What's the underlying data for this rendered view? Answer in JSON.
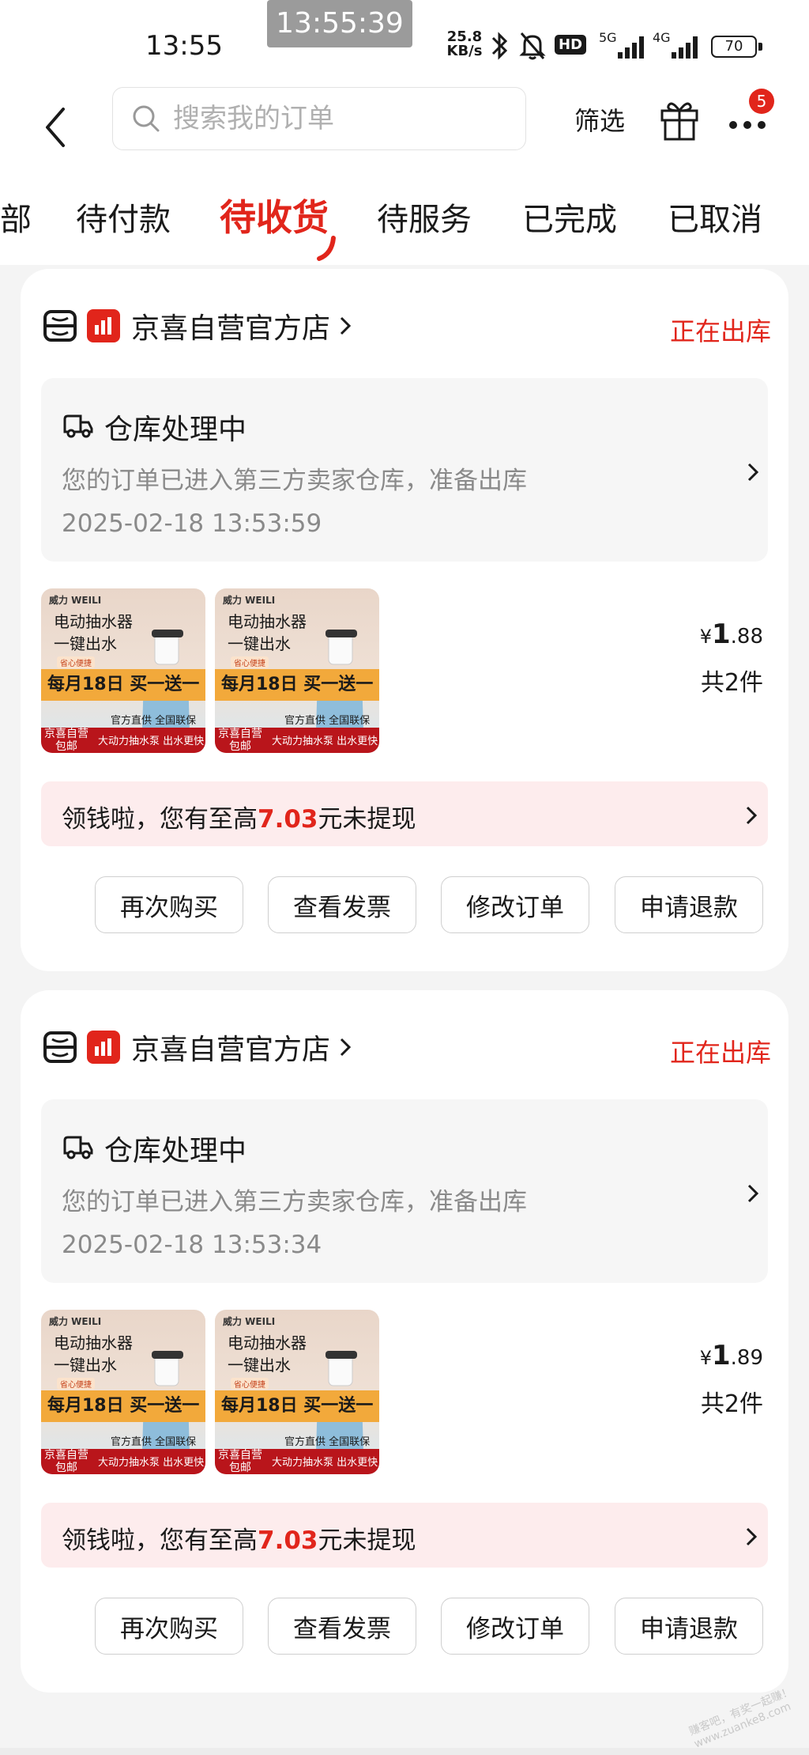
{
  "status_bar": {
    "time": "13:55",
    "overlay_time": "13:55:39",
    "net_speed_value": "25.8",
    "net_speed_unit": "KB/s",
    "hd_label": "HD",
    "net_5g": "5G",
    "net_4g": "4G",
    "battery": "70"
  },
  "header": {
    "search_placeholder": "搜索我的订单",
    "filter_label": "筛选",
    "more_badge": "5"
  },
  "tabs": [
    {
      "label": "部",
      "active": false
    },
    {
      "label": "待付款",
      "active": false
    },
    {
      "label": "待收货",
      "active": true
    },
    {
      "label": "待服务",
      "active": false
    },
    {
      "label": "已完成",
      "active": false
    },
    {
      "label": "已取消",
      "active": false
    }
  ],
  "orders": [
    {
      "shop_name": "京喜自营官方店",
      "status": "正在出库",
      "logistics_title": "仓库处理中",
      "logistics_desc": "您的订单已进入第三方卖家仓库，准备出库",
      "logistics_time": "2025-02-18 13:53:59",
      "product": {
        "brand": "威力 WEILI",
        "title_line1": "电动抽水器",
        "title_line2": "一键出水",
        "tag": "省心便捷",
        "promo": "每月18日 买一送一",
        "foot_a": "京喜自营 包邮",
        "foot_b": "大动力抽水泵 出水更快",
        "foot_c": "官方直供 全国联保"
      },
      "price_currency": "¥",
      "price_int": "1",
      "price_dec": ".88",
      "quantity": "共2件",
      "cash_prefix": "领钱啦，您有至高",
      "cash_amount": "7.03",
      "cash_suffix": "元未提现",
      "actions": [
        "再次购买",
        "查看发票",
        "修改订单",
        "申请退款"
      ]
    },
    {
      "shop_name": "京喜自营官方店",
      "status": "正在出库",
      "logistics_title": "仓库处理中",
      "logistics_desc": "您的订单已进入第三方卖家仓库，准备出库",
      "logistics_time": "2025-02-18 13:53:34",
      "product": {
        "brand": "威力 WEILI",
        "title_line1": "电动抽水器",
        "title_line2": "一键出水",
        "tag": "省心便捷",
        "promo": "每月18日 买一送一",
        "foot_a": "京喜自营 包邮",
        "foot_b": "大动力抽水泵 出水更快",
        "foot_c": "官方直供 全国联保"
      },
      "price_currency": "¥",
      "price_int": "1",
      "price_dec": ".89",
      "quantity": "共2件",
      "cash_prefix": "领钱啦，您有至高",
      "cash_amount": "7.03",
      "cash_suffix": "元未提现",
      "actions": [
        "再次购买",
        "查看发票",
        "修改订单",
        "申请退款"
      ]
    }
  ],
  "watermark": "赚客吧，有奖一起赚！ www.zuanke8.com",
  "colors": {
    "accent": "#e1251b",
    "background": "#f4f4f4",
    "card": "#ffffff"
  }
}
